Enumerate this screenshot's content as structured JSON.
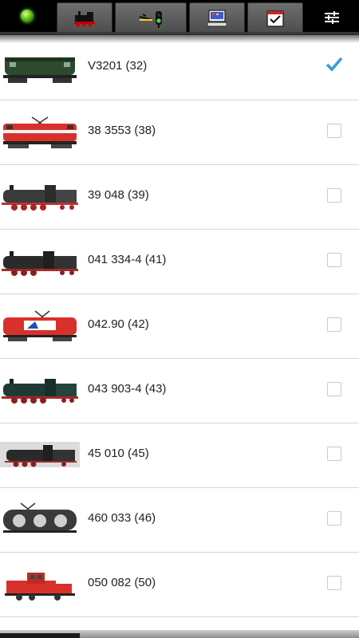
{
  "toolbar": {
    "status_led_color": "#7ed321",
    "buttons": [
      {
        "name": "locomotive-control",
        "icon": "locomotive-icon"
      },
      {
        "name": "switch-signal",
        "icon": "switch-signal-icon"
      },
      {
        "name": "layout-panel",
        "icon": "monitor-icon"
      },
      {
        "name": "locomotive-select",
        "icon": "checklist-icon"
      }
    ],
    "settings_icon": "sliders-icon"
  },
  "accent_color": "#3a9bd8",
  "locomotives": [
    {
      "label": "V3201 (32)",
      "checked": true,
      "thumb": "diesel-green"
    },
    {
      "label": "38 3553 (38)",
      "checked": false,
      "thumb": "electric-red"
    },
    {
      "label": "39 048 (39)",
      "checked": false,
      "thumb": "steam-black"
    },
    {
      "label": "041 334-4 (41)",
      "checked": false,
      "thumb": "steam-black"
    },
    {
      "label": "042.90 (42)",
      "checked": false,
      "thumb": "electric-red-modern"
    },
    {
      "label": "043 903-4 (43)",
      "checked": false,
      "thumb": "steam-green"
    },
    {
      "label": "45 010 (45)",
      "checked": false,
      "thumb": "steam-black"
    },
    {
      "label": "460 033 (46)",
      "checked": false,
      "thumb": "electric-silver"
    },
    {
      "label": "050 082 (50)",
      "checked": false,
      "thumb": "diesel-red"
    }
  ]
}
